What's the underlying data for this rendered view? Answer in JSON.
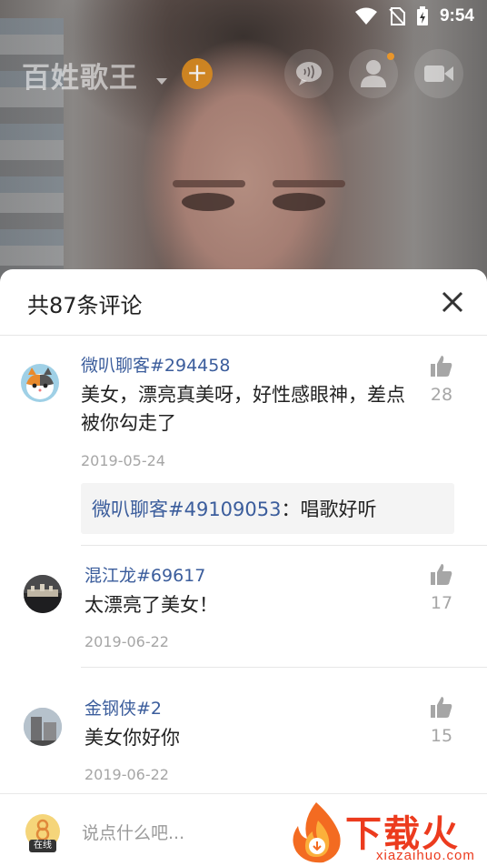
{
  "status_bar": {
    "time": "9:54"
  },
  "room": {
    "title": "百姓歌王"
  },
  "sheet": {
    "title": "共87条评论"
  },
  "comments": [
    {
      "user": "微叭聊客#294458",
      "text": "美女，漂亮真美呀，好性感眼神，差点被你勾走了",
      "date": "2019-05-24",
      "likes": "28",
      "reply": {
        "user": "微叭聊客#49109053",
        "separator": "：",
        "text": "唱歌好听"
      }
    },
    {
      "user": "混江龙#69617",
      "text": "太漂亮了美女！",
      "date": "2019-06-22",
      "likes": "17"
    },
    {
      "user": "金钢侠#2",
      "text": "美女你好你",
      "date": "2019-06-22",
      "likes": "15"
    }
  ],
  "input": {
    "placeholder": "说点什么吧...",
    "online_tag": "在线"
  },
  "watermark": {
    "main": "下载火",
    "sub": "xiazaihuo.com"
  },
  "icons": {
    "add": "plus-icon",
    "chat": "chat-bubble-icon",
    "user": "user-icon",
    "video": "video-camera-icon",
    "close": "close-icon",
    "like": "thumbs-up-icon"
  },
  "colors": {
    "username": "#3b5d9c",
    "accent_orange": "#d98a1e",
    "watermark": "#ec3b1e"
  }
}
